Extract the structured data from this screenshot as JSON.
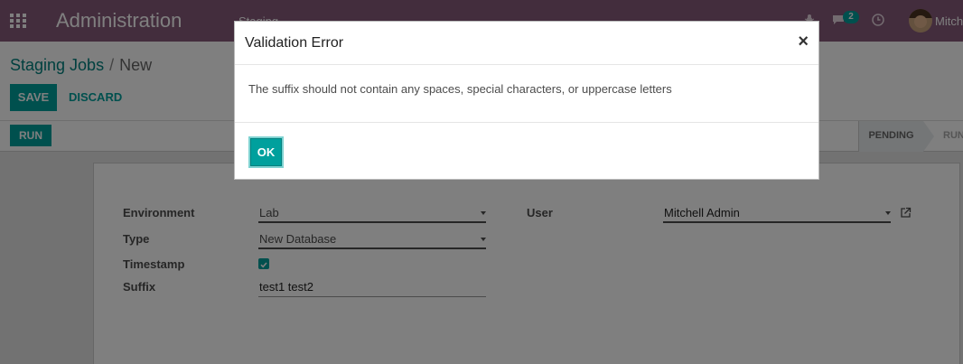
{
  "navbar": {
    "app_title": "Administration",
    "menu_item": "Staging",
    "chat_count": "2",
    "user_name": "Mitchell Admin",
    "background_color": "#875a7b"
  },
  "breadcrumb": {
    "parent": "Staging Jobs",
    "separator": "/",
    "current": "New"
  },
  "buttons": {
    "save": "SAVE",
    "discard": "DISCARD",
    "run": "RUN",
    "ok": "OK"
  },
  "statusbar": {
    "stages": [
      "PENDING",
      "RUNNING"
    ]
  },
  "form": {
    "environment": {
      "label": "Environment",
      "value": "Lab"
    },
    "type": {
      "label": "Type",
      "value": "New Database"
    },
    "timestamp": {
      "label": "Timestamp",
      "checked": true
    },
    "suffix": {
      "label": "Suffix",
      "value": "test1 test2"
    },
    "user": {
      "label": "User",
      "value": "Mitchell Admin"
    }
  },
  "dialog": {
    "title": "Validation Error",
    "message": "The suffix should not contain any spaces, special characters, or uppercase letters",
    "close_symbol": "×"
  },
  "colors": {
    "primary": "#00a09d",
    "link": "#00817e"
  },
  "icons": [
    "apps-grid-icon",
    "bug-icon",
    "chat-icon",
    "clock-icon",
    "external-link-icon",
    "checkmark-icon",
    "close-icon"
  ]
}
